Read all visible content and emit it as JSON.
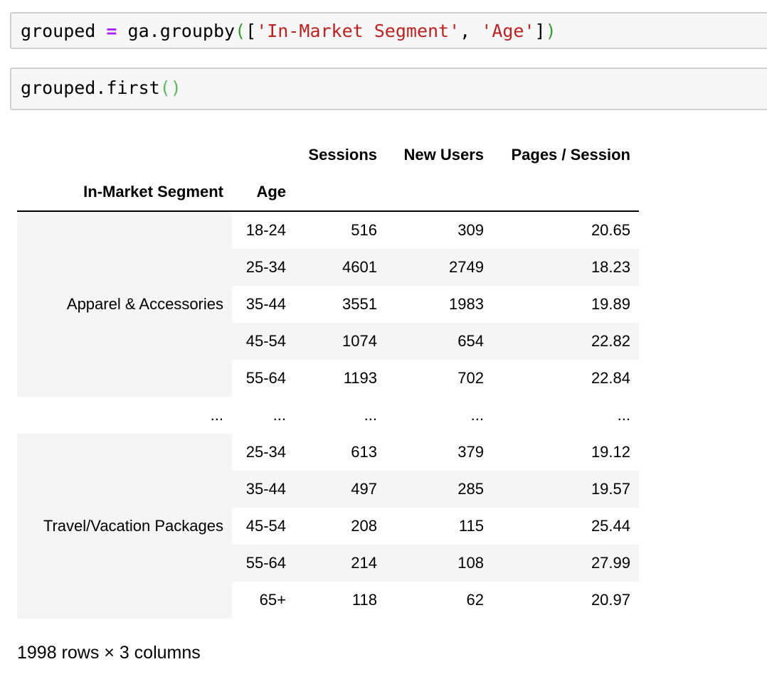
{
  "cells": [
    {
      "tokens": [
        {
          "text": "grouped ",
          "cls": ""
        },
        {
          "text": "=",
          "cls": "tok-op"
        },
        {
          "text": " ga.groupby",
          "cls": ""
        },
        {
          "text": "(",
          "cls": "tok-par"
        },
        {
          "text": "[",
          "cls": ""
        },
        {
          "text": "'In-Market Segment'",
          "cls": "tok-str"
        },
        {
          "text": ", ",
          "cls": ""
        },
        {
          "text": "'Age'",
          "cls": "tok-str"
        },
        {
          "text": "]",
          "cls": ""
        },
        {
          "text": ")",
          "cls": "tok-par"
        }
      ]
    },
    {
      "tokens": [
        {
          "text": "grouped.first",
          "cls": ""
        },
        {
          "text": "()",
          "cls": "tok-par-g"
        }
      ]
    }
  ],
  "table": {
    "columns": [
      "Sessions",
      "New Users",
      "Pages / Session"
    ],
    "index_names": [
      "In-Market Segment",
      "Age"
    ],
    "groups": [
      {
        "segment": "Apparel & Accessories",
        "rows": [
          {
            "age": "18-24",
            "sessions": "516",
            "new_users": "309",
            "pages": "20.65"
          },
          {
            "age": "25-34",
            "sessions": "4601",
            "new_users": "2749",
            "pages": "18.23"
          },
          {
            "age": "35-44",
            "sessions": "3551",
            "new_users": "1983",
            "pages": "19.89"
          },
          {
            "age": "45-54",
            "sessions": "1074",
            "new_users": "654",
            "pages": "22.82"
          },
          {
            "age": "55-64",
            "sessions": "1193",
            "new_users": "702",
            "pages": "22.84"
          }
        ]
      },
      {
        "segment": "Travel/Vacation Packages",
        "rows": [
          {
            "age": "25-34",
            "sessions": "613",
            "new_users": "379",
            "pages": "19.12"
          },
          {
            "age": "35-44",
            "sessions": "497",
            "new_users": "285",
            "pages": "19.57"
          },
          {
            "age": "45-54",
            "sessions": "208",
            "new_users": "115",
            "pages": "25.44"
          },
          {
            "age": "55-64",
            "sessions": "214",
            "new_users": "108",
            "pages": "27.99"
          },
          {
            "age": "65+",
            "sessions": "118",
            "new_users": "62",
            "pages": "20.97"
          }
        ]
      }
    ],
    "ellipsis": "..."
  },
  "footer": "1998 rows × 3 columns"
}
